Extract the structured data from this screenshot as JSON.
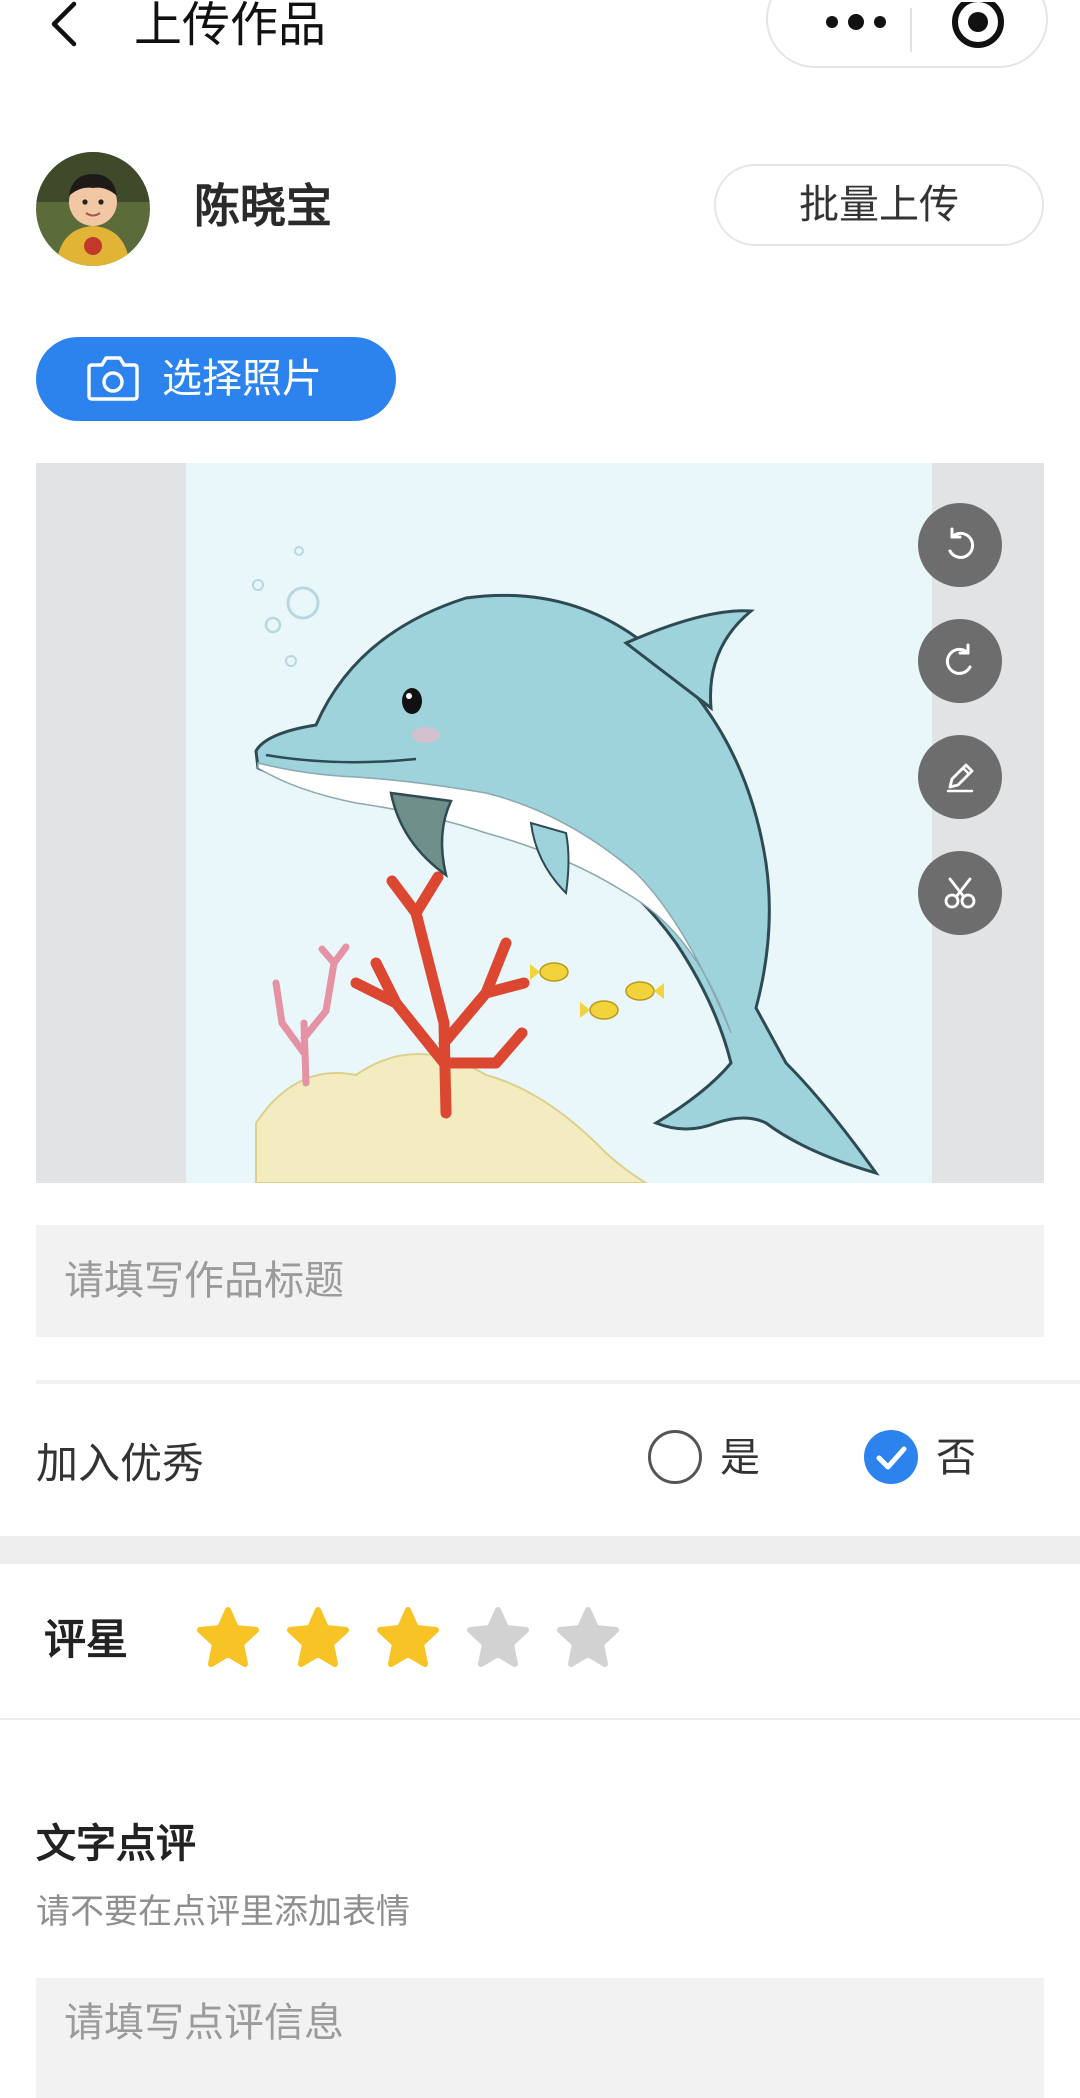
{
  "header": {
    "title": "上传作品",
    "back_icon": "chevron-left-icon",
    "more_icon": "more-dots-icon",
    "target_icon": "target-icon"
  },
  "profile": {
    "name": "陈晓宝",
    "batch_upload_label": "批量上传"
  },
  "select_photo": {
    "label": "选择照片",
    "icon": "camera-icon",
    "color": "#2d83ee"
  },
  "editor": {
    "tools": [
      "rotate-left-icon",
      "rotate-right-icon",
      "pencil-icon",
      "scissors-icon"
    ]
  },
  "title_field": {
    "placeholder": "请填写作品标题"
  },
  "excellent": {
    "label": "加入优秀",
    "options": [
      {
        "label": "是",
        "selected": false
      },
      {
        "label": "否",
        "selected": true
      }
    ],
    "accent": "#2d83ee"
  },
  "rating": {
    "label": "评星",
    "value": 3,
    "max": 5,
    "active_color": "#f7c325",
    "inactive_color": "#d2d2d2"
  },
  "comment": {
    "title": "文字点评",
    "hint": "请不要在点评里添加表情",
    "placeholder": "请填写点评信息"
  }
}
